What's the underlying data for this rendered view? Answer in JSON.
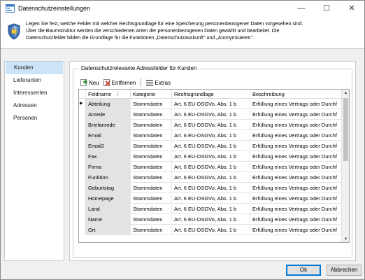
{
  "window": {
    "title": "Datenschutzeinstellungen",
    "minimize": "—",
    "maximize": "☐",
    "close": "✕"
  },
  "info": {
    "line1": "Legen Sie fest, welche Felder mit welcher Rechtsgrundlage für eine Speicherung personenbezogener Daten vorgesehen sind.",
    "line2": "Über die Baumstruktur werden die verschiedenen Arten der personenbezogenen Daten gewählt und bearbeitet. Die",
    "line3": "Datenschutzfelder bilden die Grundlage für die Funktionen „Datenschutzauskunft\" und „Anonymisieren\"."
  },
  "sidebar": {
    "items": [
      {
        "label": "Kunden"
      },
      {
        "label": "Lieferanten"
      },
      {
        "label": "Interessenten"
      },
      {
        "label": "Adressen"
      },
      {
        "label": "Personen"
      }
    ]
  },
  "panel": {
    "group_title": "Datenschutzrelevante Adressfelder für Kunden",
    "toolbar": {
      "new_label": "Neu",
      "remove_label": "Entfernen",
      "extras_label": "Extras"
    }
  },
  "table": {
    "headers": [
      "Feldname",
      "Kategorie",
      "Rechtsgrundlage",
      "Beschreibung"
    ],
    "sort_indicator": "/",
    "current_row_marker": "▶",
    "rows": [
      [
        "Abteilung",
        "Stammdaten",
        "Art. 6 EU-DSGVo, Abs. 1 b",
        "Erfüllung eines Vertrags oder Durchf"
      ],
      [
        "Anrede",
        "Stammdaten",
        "Art. 6 EU-DSGVo, Abs. 1 b",
        "Erfüllung eines Vertrags oder Durchf"
      ],
      [
        "Briefanrede",
        "Stammdaten",
        "Art. 6 EU-DSGVo, Abs. 1 b",
        "Erfüllung eines Vertrags oder Durchf"
      ],
      [
        "Email",
        "Stammdaten",
        "Art. 6 EU-DSGVo, Abs. 1 b",
        "Erfüllung eines Vertrags oder Durchf"
      ],
      [
        "Email2",
        "Stammdaten",
        "Art. 6 EU-DSGVo, Abs. 1 b",
        "Erfüllung eines Vertrags oder Durchf"
      ],
      [
        "Fax",
        "Stammdaten",
        "Art. 6 EU-DSGVo, Abs. 1 b",
        "Erfüllung eines Vertrags oder Durchf"
      ],
      [
        "Firma",
        "Stammdaten",
        "Art. 6 EU-DSGVo, Abs. 1 b",
        "Erfüllung eines Vertrags oder Durchf"
      ],
      [
        "Funktion",
        "Stammdaten",
        "Art. 6 EU-DSGVo, Abs. 1 b",
        "Erfüllung eines Vertrags oder Durchf"
      ],
      [
        "Geburtstag",
        "Stammdaten",
        "Art. 6 EU-DSGVo, Abs. 1 b",
        "Erfüllung eines Vertrags oder Durchf"
      ],
      [
        "Homepage",
        "Stammdaten",
        "Art. 6 EU-DSGVo, Abs. 1 b",
        "Erfüllung eines Vertrags oder Durchf"
      ],
      [
        "Land",
        "Stammdaten",
        "Art. 6 EU-DSGVo, Abs. 1 b",
        "Erfüllung eines Vertrags oder Durchf"
      ],
      [
        "Name",
        "Stammdaten",
        "Art. 6 EU-DSGVo, Abs. 1 b",
        "Erfüllung eines Vertrags oder Durchf"
      ],
      [
        "Ort",
        "Stammdaten",
        "Art. 6 EU-DSGVo, Abs. 1 b",
        "Erfüllung eines Vertrags oder Durchf"
      ]
    ]
  },
  "buttons": {
    "ok": "Ok",
    "cancel": "Abbrechen"
  },
  "colors": {
    "accent": "#0078d7",
    "selection": "#cce4f7",
    "new_icon": "#3c9a3c",
    "remove_icon": "#d03a2a"
  }
}
